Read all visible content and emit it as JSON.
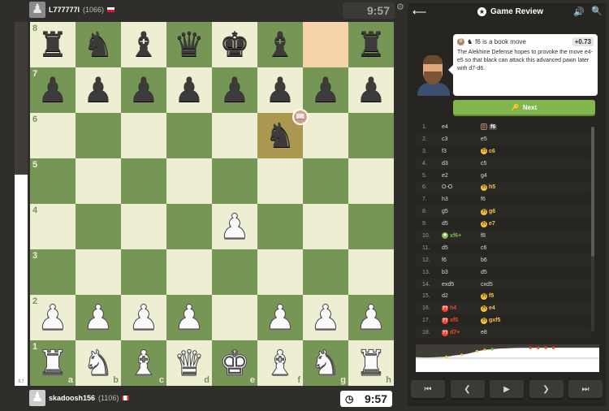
{
  "top_player": {
    "name": "L777777l",
    "rating": "(1066)",
    "clock": "9:57",
    "avatar_icon": "pawn-avatar-icon"
  },
  "bottom_player": {
    "name": "skadoosh156",
    "rating": "(1106)",
    "clock": "9:57",
    "avatar_icon": "pawn-avatar-icon"
  },
  "eval_bar": {
    "text": "0.7",
    "white_share": 0.58
  },
  "board": {
    "ranks": [
      "8",
      "7",
      "6",
      "5",
      "4",
      "3",
      "2",
      "1"
    ],
    "files": [
      "a",
      "b",
      "c",
      "d",
      "e",
      "f",
      "g",
      "h"
    ],
    "position": [
      [
        "br",
        "bn",
        "bb",
        "bq",
        "bk",
        "bb",
        "",
        "br"
      ],
      [
        "bp",
        "bp",
        "bp",
        "bp",
        "bp",
        "bp",
        "bp",
        "bp"
      ],
      [
        "",
        "",
        "",
        "",
        "",
        "bn",
        "",
        ""
      ],
      [
        "",
        "",
        "",
        "",
        "",
        "",
        "",
        ""
      ],
      [
        "",
        "",
        "",
        "",
        "wp",
        "",
        "",
        ""
      ],
      [
        "",
        "",
        "",
        "",
        "",
        "",
        "",
        ""
      ],
      [
        "wp",
        "wp",
        "wp",
        "wp",
        "",
        "wp",
        "wp",
        "wp"
      ],
      [
        "wr",
        "wn",
        "wb",
        "wq",
        "wk",
        "wb",
        "wn",
        "wr"
      ]
    ],
    "highlight_squares": [
      "g8",
      "f6"
    ],
    "book_badge_square": "f6"
  },
  "panel": {
    "title": "Game Review",
    "coach_message": {
      "move": "f6 is a book move",
      "piece_icon": "knight-icon",
      "eval": "+0.73",
      "text": "The Alekhine Defense hopes to provoke the move e4-e5 so that black can attack this advanced pawn later with d7-d6."
    },
    "next_label": "Next",
    "moves": [
      {
        "num": "1.",
        "white": "e4",
        "wc": "",
        "black": "f6",
        "bc": "book"
      },
      {
        "num": "2.",
        "white": "c3",
        "wc": "",
        "black": "e5",
        "bc": ""
      },
      {
        "num": "3.",
        "white": "f3",
        "wc": "",
        "black": "c6",
        "bc": "inacc"
      },
      {
        "num": "4.",
        "white": "d3",
        "wc": "",
        "black": "c5",
        "bc": ""
      },
      {
        "num": "5.",
        "white": "e2",
        "wc": "",
        "black": "g4",
        "bc": ""
      },
      {
        "num": "6.",
        "white": "O-O",
        "wc": "",
        "black": "h5",
        "bc": "inacc"
      },
      {
        "num": "7.",
        "white": "h3",
        "wc": "",
        "black": "f6",
        "bc": ""
      },
      {
        "num": "8.",
        "white": "g5",
        "wc": "",
        "black": "g6",
        "bc": "inacc"
      },
      {
        "num": "9.",
        "white": "d5",
        "wc": "",
        "black": "e7",
        "bc": "inacc"
      },
      {
        "num": "10.",
        "white": "xf6+",
        "wc": "best",
        "black": "f8",
        "bc": ""
      },
      {
        "num": "11.",
        "white": "d5",
        "wc": "",
        "black": "c6",
        "bc": ""
      },
      {
        "num": "12.",
        "white": "f6",
        "wc": "",
        "black": "b6",
        "bc": ""
      },
      {
        "num": "13.",
        "white": "b3",
        "wc": "",
        "black": "d5",
        "bc": ""
      },
      {
        "num": "14.",
        "white": "exd5",
        "wc": "",
        "black": "cxd5",
        "bc": ""
      },
      {
        "num": "15.",
        "white": "d2",
        "wc": "",
        "black": "f5",
        "bc": "inacc"
      },
      {
        "num": "16.",
        "white": "h4",
        "wc": "blun",
        "black": "e4",
        "bc": "inacc"
      },
      {
        "num": "17.",
        "white": "xf5",
        "wc": "blun",
        "black": "gxf5",
        "bc": "inacc"
      },
      {
        "num": "18.",
        "white": "d7+",
        "wc": "blun",
        "black": "e8",
        "bc": ""
      }
    ],
    "graph_evals": [
      0.7,
      0.5,
      0.6,
      0.8,
      1.0,
      2.0,
      2.5,
      3.5,
      5.0,
      6.0,
      6.5,
      7.0,
      7.2,
      7.4,
      7.5,
      7.5,
      7.5,
      7.6,
      7.6,
      7.6,
      7.6,
      7.6,
      7.6,
      7.6,
      7.6
    ],
    "nav": {
      "first": "first-move-icon",
      "prev": "prev-move-icon",
      "play": "play-icon",
      "next": "next-move-icon",
      "last": "last-move-icon"
    }
  }
}
